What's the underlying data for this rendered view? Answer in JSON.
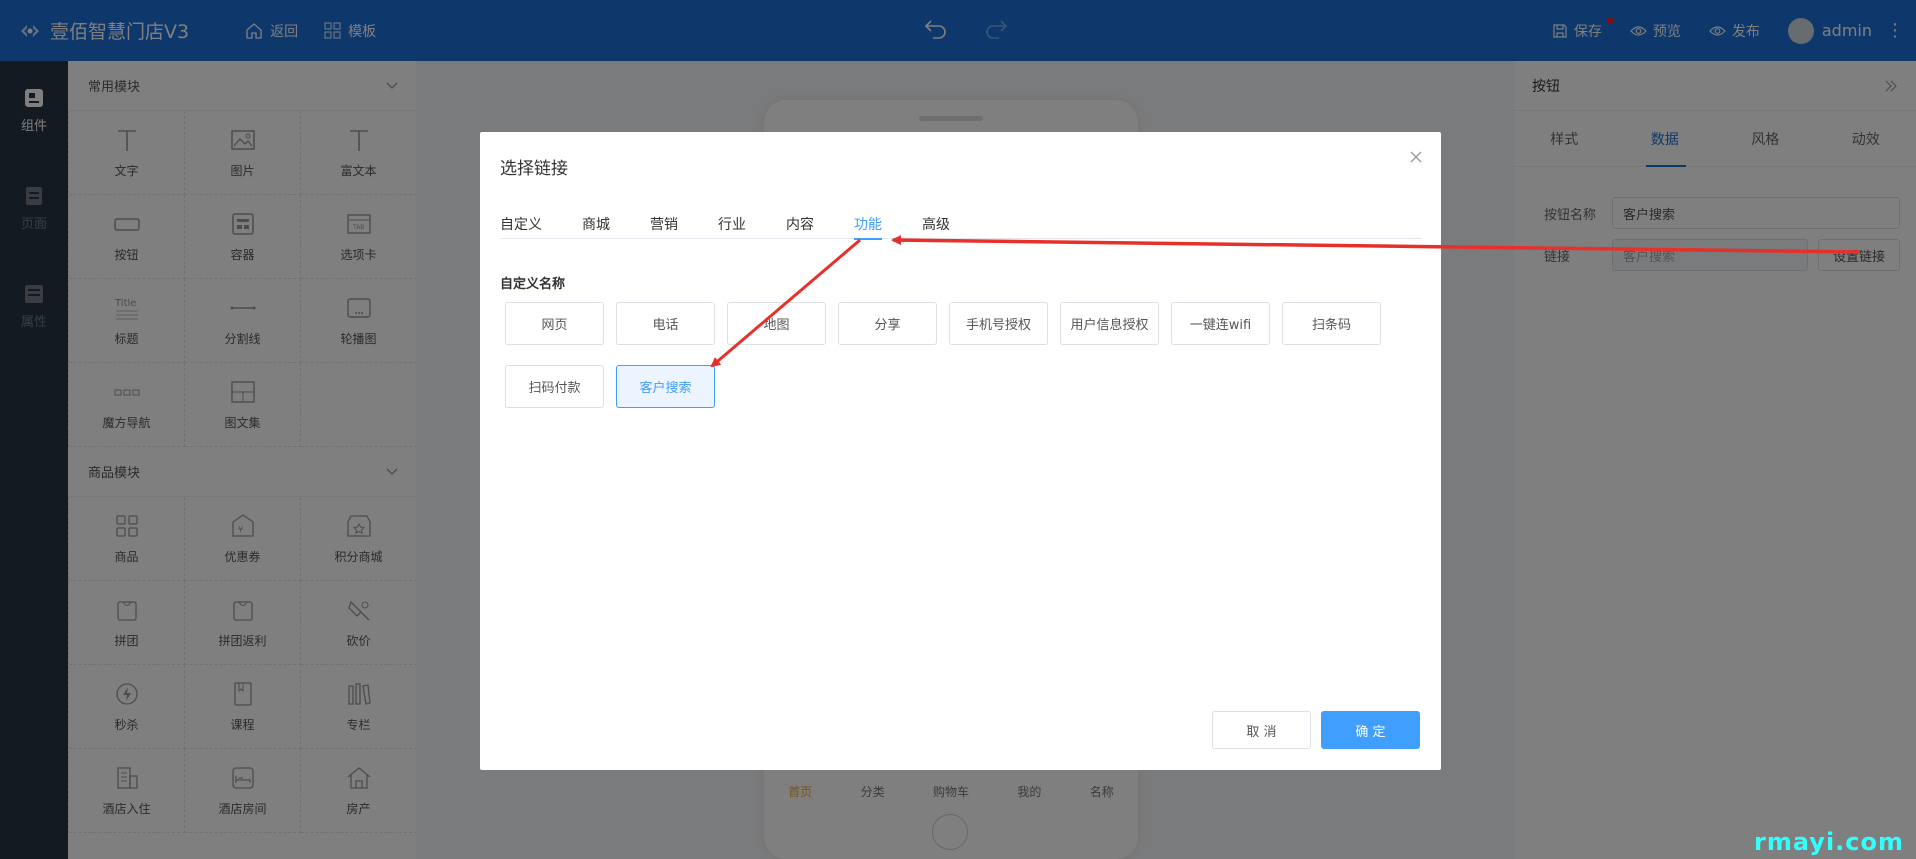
{
  "app": {
    "title": "壹佰智慧门店V3"
  },
  "topbar": {
    "nav": [
      {
        "label": "返回"
      },
      {
        "label": "模板"
      }
    ],
    "save_label": "保存",
    "preview_label": "预览",
    "publish_label": "发布",
    "user": "admin",
    "menu_glyph": "⋮"
  },
  "rail": {
    "items": [
      {
        "label": "组件"
      },
      {
        "label": "页面"
      },
      {
        "label": "属性"
      }
    ]
  },
  "components": {
    "common_title": "常用模块",
    "common": [
      {
        "label": "文字",
        "icon": "text-icon"
      },
      {
        "label": "图片",
        "icon": "image-icon"
      },
      {
        "label": "富文本",
        "icon": "rich-text-icon"
      },
      {
        "label": "按钮",
        "icon": "button-icon"
      },
      {
        "label": "容器",
        "icon": "container-icon"
      },
      {
        "label": "选项卡",
        "icon": "tab-icon"
      },
      {
        "label": "标题",
        "icon": "title-icon"
      },
      {
        "label": "分割线",
        "icon": "divider-icon"
      },
      {
        "label": "轮播图",
        "icon": "carousel-icon"
      },
      {
        "label": "魔方导航",
        "icon": "cube-nav-icon"
      },
      {
        "label": "图文集",
        "icon": "gallery-icon"
      }
    ],
    "goods_title": "商品模块",
    "goods": [
      {
        "label": "商品",
        "icon": "goods-icon"
      },
      {
        "label": "优惠券",
        "icon": "coupon-icon"
      },
      {
        "label": "积分商城",
        "icon": "points-mall-icon"
      },
      {
        "label": "拼团",
        "icon": "group-buy-icon"
      },
      {
        "label": "拼团返利",
        "icon": "group-rebate-icon"
      },
      {
        "label": "砍价",
        "icon": "bargain-icon"
      },
      {
        "label": "秒杀",
        "icon": "flash-sale-icon"
      },
      {
        "label": "课程",
        "icon": "course-icon"
      },
      {
        "label": "专栏",
        "icon": "column-icon"
      },
      {
        "label": "酒店入住",
        "icon": "hotel-checkin-icon"
      },
      {
        "label": "酒店房间",
        "icon": "hotel-room-icon"
      },
      {
        "label": "房产",
        "icon": "house-icon"
      }
    ]
  },
  "phone": {
    "tabbar": [
      "首页",
      "分类",
      "购物车",
      "我的",
      "名称"
    ]
  },
  "right_panel": {
    "title": "按钮",
    "tabs": [
      "样式",
      "数据",
      "风格",
      "动效"
    ],
    "active_tab": "数据",
    "name_label": "按钮名称",
    "name_value": "客户搜索",
    "link_label": "链接",
    "link_value": "客户搜索",
    "set_link_label": "设置链接"
  },
  "modal": {
    "title": "选择链接",
    "tabs": [
      "自定义",
      "商城",
      "营销",
      "行业",
      "内容",
      "功能",
      "高级"
    ],
    "active_tab": "功能",
    "section_title": "自定义名称",
    "options": [
      "网页",
      "电话",
      "地图",
      "分享",
      "手机号授权",
      "用户信息授权",
      "一键连wifi",
      "扫条码",
      "扫码付款",
      "客户搜索"
    ],
    "selected": "客户搜索",
    "cancel_label": "取 消",
    "ok_label": "确 定"
  },
  "annotation": {
    "arrow_color": "#e8302a"
  },
  "watermark": "rmayi.com",
  "colors": {
    "topbar": "#1d6fd6",
    "rail": "#283443",
    "primary": "#409eff"
  }
}
